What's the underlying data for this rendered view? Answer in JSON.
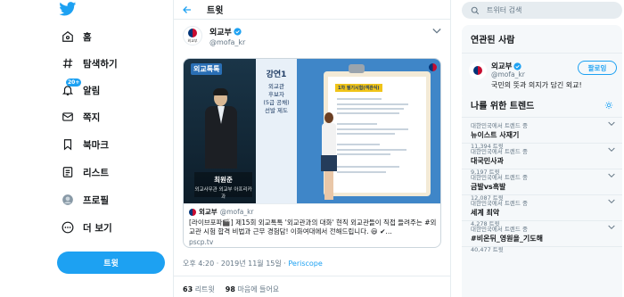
{
  "nav": {
    "items": [
      {
        "label": "홈",
        "icon": "home-icon"
      },
      {
        "label": "탐색하기",
        "icon": "hashtag-icon"
      },
      {
        "label": "알림",
        "icon": "bell-icon",
        "badge": "20+"
      },
      {
        "label": "쪽지",
        "icon": "envelope-icon"
      },
      {
        "label": "북마크",
        "icon": "bookmark-icon"
      },
      {
        "label": "리스트",
        "icon": "list-icon"
      },
      {
        "label": "프로필",
        "icon": "profile-icon"
      },
      {
        "label": "더 보기",
        "icon": "more-icon"
      }
    ],
    "tweet_button": "트윗"
  },
  "main": {
    "title": "트윗",
    "author": {
      "name": "외교부",
      "handle": "@mofa_kr",
      "avatar_caption": "외교부"
    },
    "video": {
      "badge": "외교톡톡",
      "caption_name": "최원준",
      "caption_role": "외교사무관 외교부 아프리카과",
      "side_title": "강연1",
      "side_text": "외교관\n후보자\n(5급 공채)\n선발 제도",
      "paper_title": "1차 필기시험(객관식)"
    },
    "card": {
      "name": "외교부",
      "handle": "@mofa_kr",
      "text": "[라이브포파🎬] 제15회 외교톡톡 '외교관과의 대화' 현직 외교관들이 직접 들려주는 #외교관 시험 합격 비법과 근무 경험담! 이화여대에서 전해드립니다. 😃 ✔…",
      "link": "pscp.tv"
    },
    "timestamp": "오후 4:20 · 2019년 11월 15일 · ",
    "via": "Periscope",
    "stats": {
      "retweets_count": "63",
      "retweets_label": "리트윗",
      "likes_count": "98",
      "likes_label": "마음에 들어요"
    }
  },
  "right": {
    "search_placeholder": "트위터 검색",
    "related": {
      "title": "연관된 사람",
      "name": "외교부",
      "handle": "@mofa_kr",
      "bio": "국민의 뜻과 의지가 담긴 외교!",
      "follow_label": "팔로잉"
    },
    "trends": {
      "title": "나를 위한 트렌드",
      "items": [
        {
          "context": "대한민국에서 트렌드 중",
          "name": "뉴이스트 사재기",
          "count": "11,394 트윗"
        },
        {
          "context": "대한민국에서 트렌드 중",
          "name": "대국민사과",
          "count": "9,197 트윗"
        },
        {
          "context": "대한민국에서 트렌드 중",
          "name": "금발vs흑발",
          "count": "12,087 트윗"
        },
        {
          "context": "대한민국에서 트렌드 중",
          "name": "세계 최악",
          "count": "4,278 트윗"
        },
        {
          "context": "대한민국에서 트렌드 중",
          "name": "#비온뒤_영원을_기도해",
          "count": "40,477 트윗"
        }
      ]
    }
  },
  "colors": {
    "accent": "#1da1f2",
    "border": "#e6ecf0",
    "muted": "#657786"
  }
}
